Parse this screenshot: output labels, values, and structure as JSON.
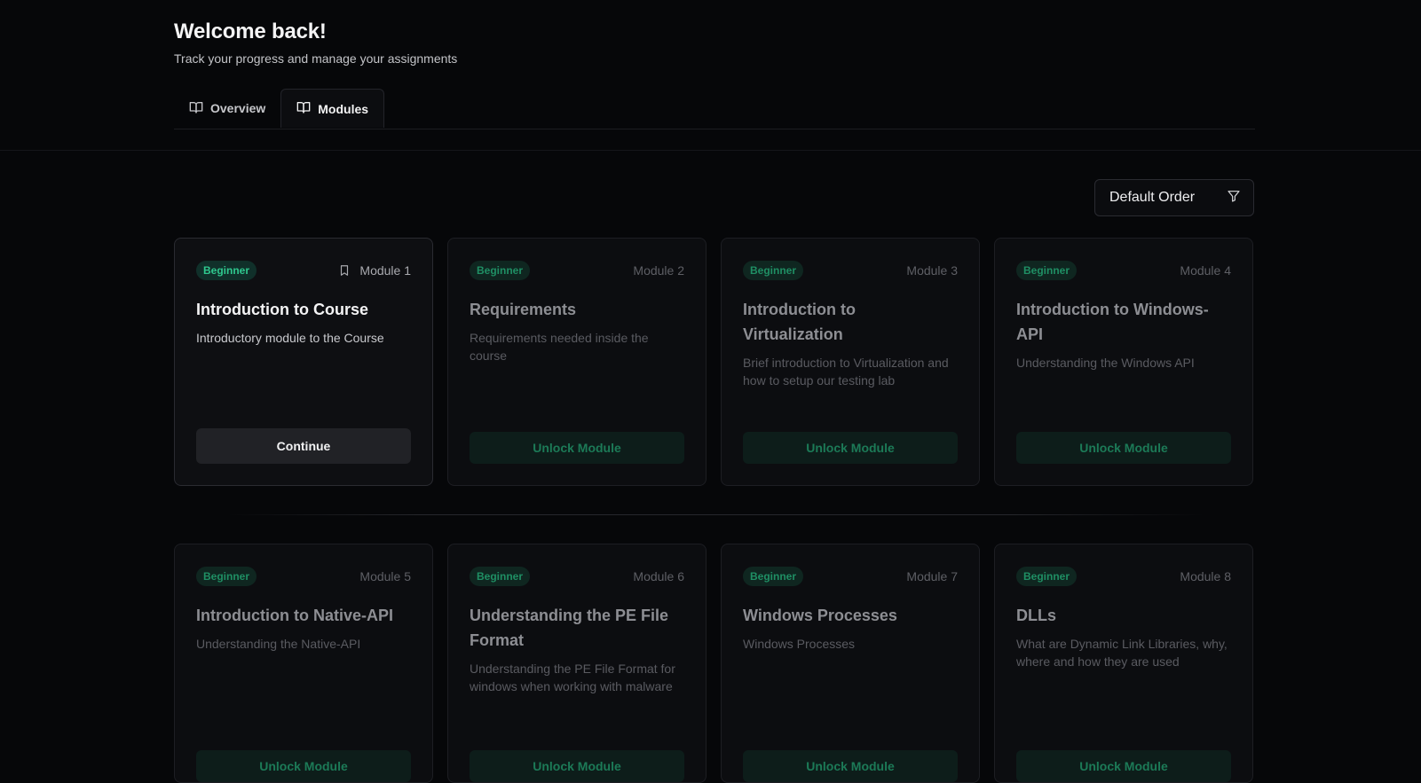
{
  "header": {
    "title": "Welcome back!",
    "subtitle": "Track your progress and manage your assignments"
  },
  "tabs": [
    {
      "label": "Overview",
      "icon": "book-open-icon",
      "active": false
    },
    {
      "label": "Modules",
      "icon": "book-open-icon",
      "active": true
    }
  ],
  "sort": {
    "selected": "Default Order",
    "icon": "filter-icon"
  },
  "colors": {
    "background": "#060709",
    "badge_text": "#2fc88e",
    "badge_bg": "#10302a",
    "locked_button_text": "#1c7a57",
    "locked_button_bg": "#0d1d1a"
  },
  "modules": [
    {
      "level": "Beginner",
      "number": "Module 1",
      "title": "Introduction to Course",
      "description": "Introductory module to the Course",
      "action": "Continue",
      "bookmark_icon": "bookmark-icon"
    },
    {
      "level": "Beginner",
      "number": "Module 2",
      "title": "Requirements",
      "description": "Requirements needed inside the course",
      "action": "Unlock Module"
    },
    {
      "level": "Beginner",
      "number": "Module 3",
      "title": "Introduction to Virtualization",
      "description": "Brief introduction to Virtualization and how to setup our testing lab",
      "action": "Unlock Module"
    },
    {
      "level": "Beginner",
      "number": "Module 4",
      "title": "Introduction to Windows-API",
      "description": "Understanding the Windows API",
      "action": "Unlock Module"
    },
    {
      "level": "Beginner",
      "number": "Module 5",
      "title": "Introduction to Native-API",
      "description": "Understanding the Native-API",
      "action": "Unlock Module"
    },
    {
      "level": "Beginner",
      "number": "Module 6",
      "title": "Understanding the PE File Format",
      "description": "Understanding the PE File Format for windows when working with malware",
      "action": "Unlock Module"
    },
    {
      "level": "Beginner",
      "number": "Module 7",
      "title": "Windows Processes",
      "description": "Windows Processes",
      "action": "Unlock Module"
    },
    {
      "level": "Beginner",
      "number": "Module 8",
      "title": "DLLs",
      "description": "What are Dynamic Link Libraries, why, where and how they are used",
      "action": "Unlock Module"
    }
  ]
}
